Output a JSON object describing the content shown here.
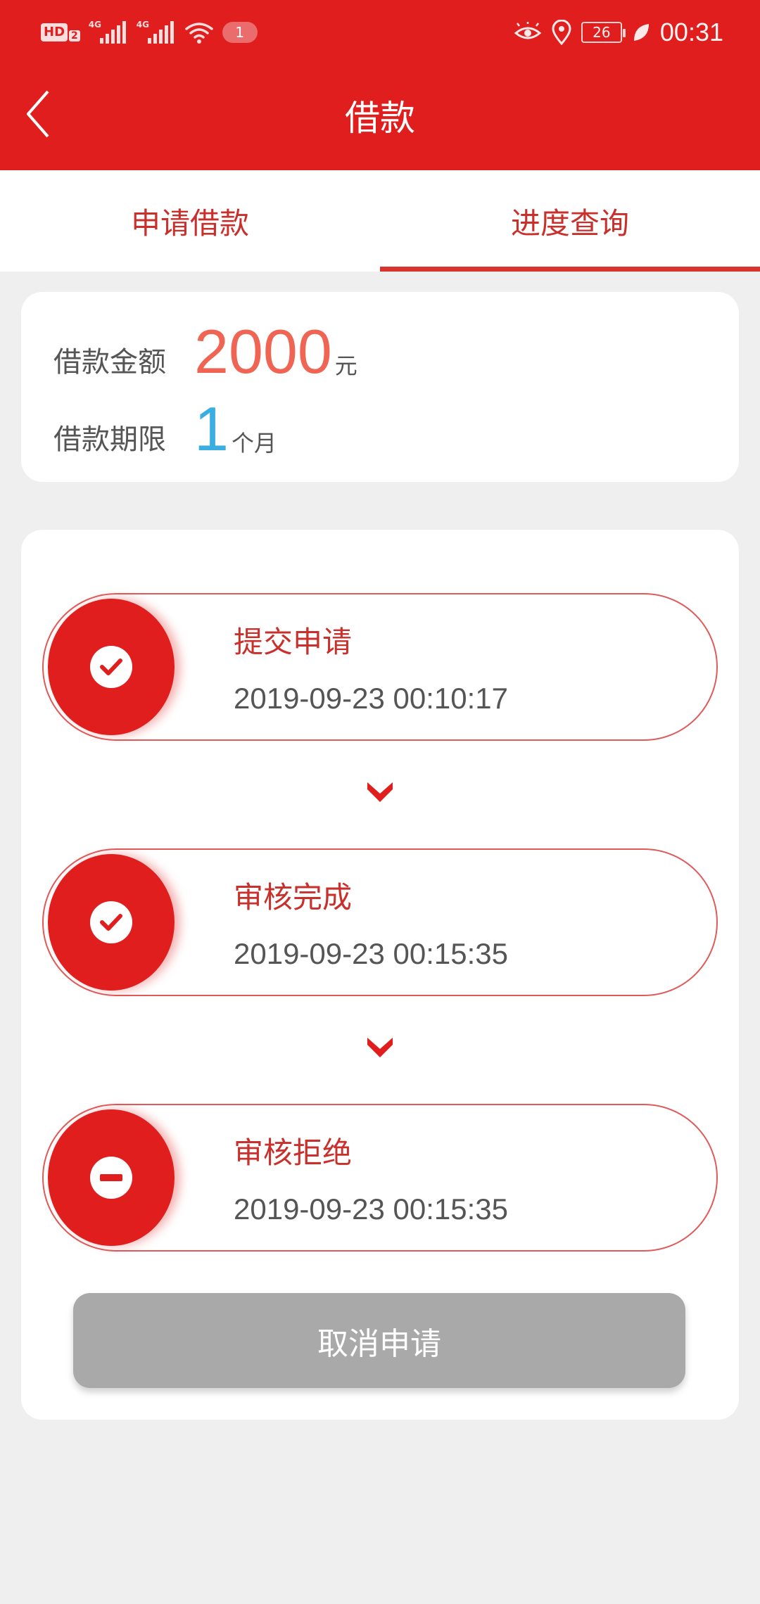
{
  "status_bar": {
    "hd_label": "HD",
    "hd_sub": "2",
    "network_1": "4G",
    "network_2": "4G",
    "notification_count": "1",
    "battery": "26",
    "time": "00:31"
  },
  "nav": {
    "title": "借款"
  },
  "tabs": [
    {
      "label": "申请借款",
      "active": false
    },
    {
      "label": "进度查询",
      "active": true
    }
  ],
  "loan": {
    "amount_label": "借款金额",
    "amount_value": "2000",
    "amount_unit": "元",
    "term_label": "借款期限",
    "term_value": "1",
    "term_unit": "个月"
  },
  "steps": [
    {
      "title": "提交申请",
      "time": "2019-09-23 00:10:17",
      "status": "check-icon"
    },
    {
      "title": "审核完成",
      "time": "2019-09-23 00:15:35",
      "status": "check-icon"
    },
    {
      "title": "审核拒绝",
      "time": "2019-09-23 00:15:35",
      "status": "minus-icon"
    }
  ],
  "cancel_button": "取消申请",
  "colors": {
    "brand_red": "#e01e1e",
    "amount_color": "#ef6452",
    "term_color": "#3aaee0",
    "disabled_button": "#a9a9a9"
  }
}
